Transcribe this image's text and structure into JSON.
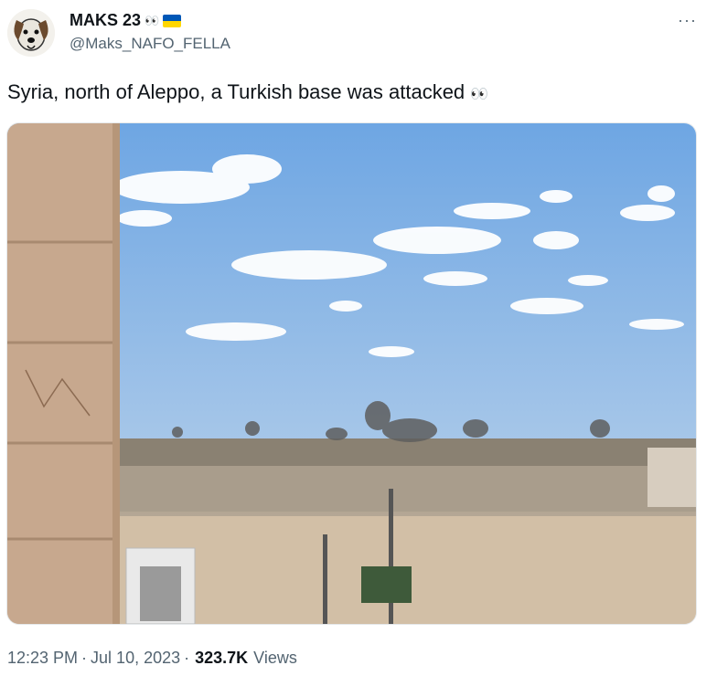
{
  "author": {
    "display_name": "MAKS 23",
    "handle": "@Maks_NAFO_FELLA",
    "eyes_emoji": "👀",
    "avatar_icon": "dog-avatar-icon",
    "flag_icon": "ukraine-flag-icon",
    "flag_colors": [
      "#0057b7",
      "#ffd700"
    ]
  },
  "tweet": {
    "text": "Syria, north of Aleppo, a Turkish base was attacked",
    "text_emoji": "👀",
    "more_label": "···"
  },
  "media": {
    "description_icon": "photo-icon",
    "colors": {
      "sky": "#7fb0e6",
      "ground": "#cbb69e",
      "smoke": "#5e5e5e"
    }
  },
  "meta": {
    "time": "12:23 PM",
    "separator": "·",
    "date": "Jul 10, 2023",
    "separator2": "·",
    "views_count": "323.7K",
    "views_label": "Views"
  }
}
